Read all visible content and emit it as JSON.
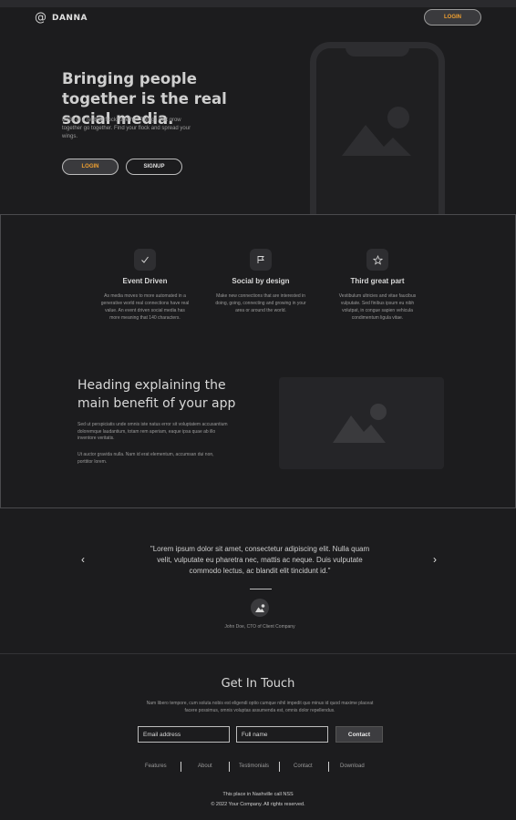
{
  "brand": {
    "symbol": "@",
    "name": "DANNA"
  },
  "header": {
    "login_label": "LOGIN"
  },
  "hero": {
    "title": "Bringing people together is the real social media.",
    "subtitle": "Birds of a feather flock together. Things that grow together go together. Find your flock and spread your wings.",
    "login_label": "LOGIN",
    "signup_label": "SIGNUP"
  },
  "features": [
    {
      "icon": "check-icon",
      "title": "Event Driven",
      "desc": "As media moves to more automated in a generative world real connections have real value. An event driven social media has more meaning that 140 characters."
    },
    {
      "icon": "flag-icon",
      "title": "Social by design",
      "desc": "Make new connections that are interested in doing, going, connecting and growing in your area or around the world."
    },
    {
      "icon": "star-icon",
      "title": "Third great part",
      "desc": "Vestibulum ultricies and vitae faucibus vulputate. Sed finibus ipsum eu nibh volutpat, in congue sapien vehicula condimentum ligula vitae."
    }
  ],
  "benefit": {
    "title": "Heading explaining the main benefit of your app",
    "p1": "Sed ut perspiciatis unde omnis iste natus error sit voluptatem accusantium doloremque laudantium, totam rem aperiam, eaque ipsa quae ab illo inventore veritatis.",
    "p2": "Ut auctor gravida nulla. Nam id erat elementum, accumsan dui non, porttitor lorem."
  },
  "testimonial": {
    "quote": "\"Lorem ipsum dolor sit amet, consectetur adipiscing elit. Nulla quam velit, vulputate eu pharetra nec, mattis ac neque. Duis vulputate commodo lectus, ac blandit elit tincidunt id.\"",
    "author": "John Doe, CTO of Client Company",
    "prev_arrow": "‹",
    "next_arrow": "›"
  },
  "contact": {
    "title": "Get In Touch",
    "subtitle": "Nam libero tempore, cum soluta nobis est eligendi optio cumque nihil impedit quo minus id quod maxime placeat facere possimus, omnis voluptas assumenda est, omnis dolor repellendus.",
    "email_placeholder": "Email address",
    "name_placeholder": "Full name",
    "button_label": "Contact"
  },
  "footer": {
    "nav": [
      "Features",
      "About",
      "Testimonials",
      "Contact",
      "Download"
    ],
    "line1": "This place in Nashville call NSS",
    "line2": "© 2022 Your Company.  All rights reserved."
  },
  "colors": {
    "background": "#1c1c1e",
    "accent": "#f0a030"
  }
}
